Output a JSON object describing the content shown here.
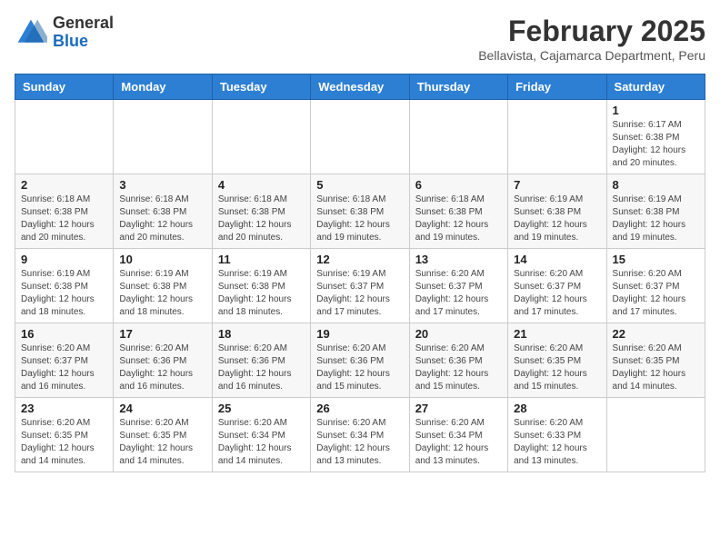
{
  "header": {
    "logo_line1": "General",
    "logo_line2": "Blue",
    "title": "February 2025",
    "subtitle": "Bellavista, Cajamarca Department, Peru"
  },
  "weekdays": [
    "Sunday",
    "Monday",
    "Tuesday",
    "Wednesday",
    "Thursday",
    "Friday",
    "Saturday"
  ],
  "weeks": [
    [
      {
        "day": "",
        "info": ""
      },
      {
        "day": "",
        "info": ""
      },
      {
        "day": "",
        "info": ""
      },
      {
        "day": "",
        "info": ""
      },
      {
        "day": "",
        "info": ""
      },
      {
        "day": "",
        "info": ""
      },
      {
        "day": "1",
        "info": "Sunrise: 6:17 AM\nSunset: 6:38 PM\nDaylight: 12 hours and 20 minutes."
      }
    ],
    [
      {
        "day": "2",
        "info": "Sunrise: 6:18 AM\nSunset: 6:38 PM\nDaylight: 12 hours and 20 minutes."
      },
      {
        "day": "3",
        "info": "Sunrise: 6:18 AM\nSunset: 6:38 PM\nDaylight: 12 hours and 20 minutes."
      },
      {
        "day": "4",
        "info": "Sunrise: 6:18 AM\nSunset: 6:38 PM\nDaylight: 12 hours and 20 minutes."
      },
      {
        "day": "5",
        "info": "Sunrise: 6:18 AM\nSunset: 6:38 PM\nDaylight: 12 hours and 19 minutes."
      },
      {
        "day": "6",
        "info": "Sunrise: 6:18 AM\nSunset: 6:38 PM\nDaylight: 12 hours and 19 minutes."
      },
      {
        "day": "7",
        "info": "Sunrise: 6:19 AM\nSunset: 6:38 PM\nDaylight: 12 hours and 19 minutes."
      },
      {
        "day": "8",
        "info": "Sunrise: 6:19 AM\nSunset: 6:38 PM\nDaylight: 12 hours and 19 minutes."
      }
    ],
    [
      {
        "day": "9",
        "info": "Sunrise: 6:19 AM\nSunset: 6:38 PM\nDaylight: 12 hours and 18 minutes."
      },
      {
        "day": "10",
        "info": "Sunrise: 6:19 AM\nSunset: 6:38 PM\nDaylight: 12 hours and 18 minutes."
      },
      {
        "day": "11",
        "info": "Sunrise: 6:19 AM\nSunset: 6:38 PM\nDaylight: 12 hours and 18 minutes."
      },
      {
        "day": "12",
        "info": "Sunrise: 6:19 AM\nSunset: 6:37 PM\nDaylight: 12 hours and 17 minutes."
      },
      {
        "day": "13",
        "info": "Sunrise: 6:20 AM\nSunset: 6:37 PM\nDaylight: 12 hours and 17 minutes."
      },
      {
        "day": "14",
        "info": "Sunrise: 6:20 AM\nSunset: 6:37 PM\nDaylight: 12 hours and 17 minutes."
      },
      {
        "day": "15",
        "info": "Sunrise: 6:20 AM\nSunset: 6:37 PM\nDaylight: 12 hours and 17 minutes."
      }
    ],
    [
      {
        "day": "16",
        "info": "Sunrise: 6:20 AM\nSunset: 6:37 PM\nDaylight: 12 hours and 16 minutes."
      },
      {
        "day": "17",
        "info": "Sunrise: 6:20 AM\nSunset: 6:36 PM\nDaylight: 12 hours and 16 minutes."
      },
      {
        "day": "18",
        "info": "Sunrise: 6:20 AM\nSunset: 6:36 PM\nDaylight: 12 hours and 16 minutes."
      },
      {
        "day": "19",
        "info": "Sunrise: 6:20 AM\nSunset: 6:36 PM\nDaylight: 12 hours and 15 minutes."
      },
      {
        "day": "20",
        "info": "Sunrise: 6:20 AM\nSunset: 6:36 PM\nDaylight: 12 hours and 15 minutes."
      },
      {
        "day": "21",
        "info": "Sunrise: 6:20 AM\nSunset: 6:35 PM\nDaylight: 12 hours and 15 minutes."
      },
      {
        "day": "22",
        "info": "Sunrise: 6:20 AM\nSunset: 6:35 PM\nDaylight: 12 hours and 14 minutes."
      }
    ],
    [
      {
        "day": "23",
        "info": "Sunrise: 6:20 AM\nSunset: 6:35 PM\nDaylight: 12 hours and 14 minutes."
      },
      {
        "day": "24",
        "info": "Sunrise: 6:20 AM\nSunset: 6:35 PM\nDaylight: 12 hours and 14 minutes."
      },
      {
        "day": "25",
        "info": "Sunrise: 6:20 AM\nSunset: 6:34 PM\nDaylight: 12 hours and 14 minutes."
      },
      {
        "day": "26",
        "info": "Sunrise: 6:20 AM\nSunset: 6:34 PM\nDaylight: 12 hours and 13 minutes."
      },
      {
        "day": "27",
        "info": "Sunrise: 6:20 AM\nSunset: 6:34 PM\nDaylight: 12 hours and 13 minutes."
      },
      {
        "day": "28",
        "info": "Sunrise: 6:20 AM\nSunset: 6:33 PM\nDaylight: 12 hours and 13 minutes."
      },
      {
        "day": "",
        "info": ""
      }
    ]
  ]
}
